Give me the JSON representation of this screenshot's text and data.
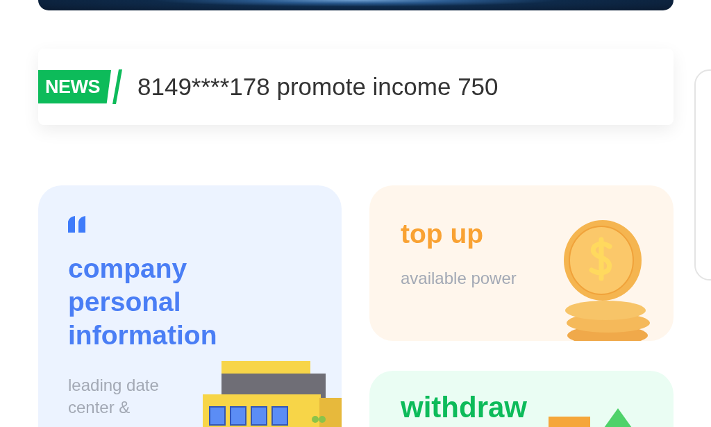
{
  "news": {
    "badge": "NEWS",
    "message": "8149****178 promote income 750"
  },
  "cards": [
    {
      "kind": "company",
      "title": "company personal information",
      "subtitle": "leading date center &"
    },
    {
      "kind": "topup",
      "title": "top up",
      "subtitle": "available power"
    },
    {
      "kind": "withdraw",
      "title": "withdraw"
    }
  ]
}
